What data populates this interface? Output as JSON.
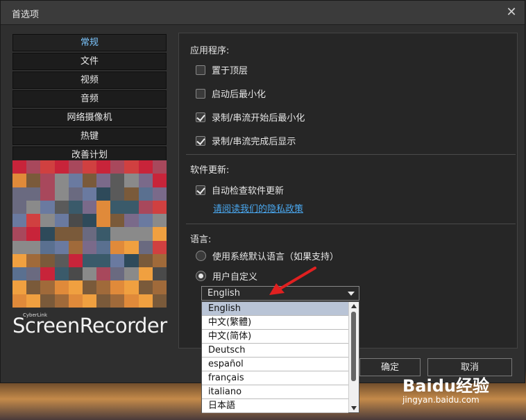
{
  "window": {
    "title": "首选项"
  },
  "nav": {
    "items": [
      "常规",
      "文件",
      "视频",
      "音频",
      "网络摄像机",
      "热键",
      "改善计划"
    ],
    "active_index": 0
  },
  "brand": {
    "small": "CyberLink",
    "big": "ScreenRecorder"
  },
  "app_section": {
    "title": "应用程序:",
    "options": [
      {
        "label": "置于顶层",
        "checked": false
      },
      {
        "label": "启动后最小化",
        "checked": false
      },
      {
        "label": "录制/串流开始后最小化",
        "checked": true
      },
      {
        "label": "录制/串流完成后显示",
        "checked": true
      }
    ]
  },
  "update_section": {
    "title": "软件更新:",
    "auto_check": {
      "label": "自动检查软件更新",
      "checked": true
    },
    "privacy_link": "请阅读我们的隐私政策"
  },
  "language_section": {
    "title": "语言:",
    "system_default": {
      "label": "使用系统默认语言（如果支持）",
      "selected": false
    },
    "user_defined": {
      "label": "用户自定义",
      "selected": true
    },
    "selected_value": "English",
    "options": [
      "English",
      "中文(繁體)",
      "中文(简体)",
      "Deutsch",
      "español",
      "français",
      "italiano",
      "日本語"
    ],
    "highlighted_index": 0
  },
  "buttons": {
    "ok": "确定",
    "cancel": "取消"
  },
  "watermark": {
    "logo": "Baidu经验",
    "url": "jingyan.baidu.com"
  },
  "colors": {
    "accent": "#7cc6ff",
    "link": "#4aa8f0",
    "arrow": "#e02020"
  }
}
